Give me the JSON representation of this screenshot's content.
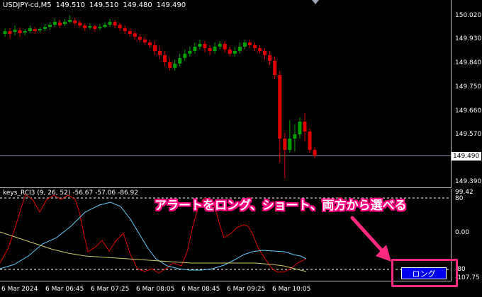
{
  "header": {
    "symbol": "USDJPY-cd,M5",
    "open": "149.510",
    "high": "149.510",
    "low": "149.480",
    "close": "149.490"
  },
  "price_axis": {
    "labels": [
      "150.020",
      "149.930",
      "149.840",
      "149.750",
      "149.660",
      "149.570",
      "149.390"
    ],
    "current_price": "149.490"
  },
  "indicator": {
    "header": "keys_RCI3 (9, 26, 52) -56.67 -57.06 -86.92",
    "axis_labels": [
      "99.42",
      "80",
      "0.00",
      "-80",
      "-107.75"
    ]
  },
  "time_axis": {
    "labels": [
      "6 Mar 2024",
      "6 Mar 06:45",
      "6 Mar 07:25",
      "6 Mar 08:05",
      "6 Mar 08:45",
      "6 Mar 09:25",
      "6 Mar 10:05"
    ]
  },
  "annotation": {
    "text": "アラートをロング、ショート、両方から選べる"
  },
  "long_button": {
    "label": "ロング",
    "color": "#0000ee"
  },
  "colors": {
    "bull": "#00a000",
    "bear": "#e00000",
    "rci_short": "#e00000",
    "rci_mid": "#66ccff",
    "rci_long": "#cccc66",
    "accent": "#ff2a7f"
  }
}
